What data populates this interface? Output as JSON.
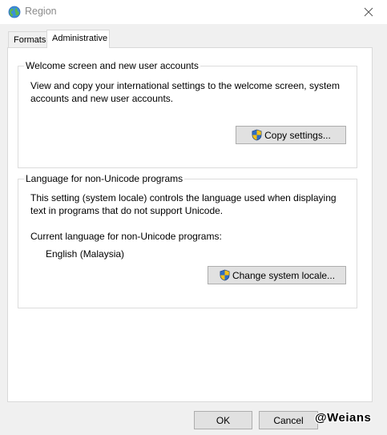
{
  "window": {
    "title": "Region",
    "icon": "globe-icon",
    "close_icon": "close-icon"
  },
  "tabs": [
    {
      "label": "Formats",
      "selected": false
    },
    {
      "label": "Administrative",
      "selected": true
    }
  ],
  "welcome_group": {
    "title": "Welcome screen and new user accounts",
    "description_line1": "View and copy your international settings to the welcome screen, system",
    "description_line2": "accounts and new user accounts.",
    "button_label": "Copy settings...",
    "button_icon": "uac-shield-icon"
  },
  "locale_group": {
    "title": "Language for non-Unicode programs",
    "description_line1": "This setting (system locale) controls the language used when displaying",
    "description_line2": "text in programs that do not support Unicode.",
    "current_label": "Current language for non-Unicode programs:",
    "current_value": "English (Malaysia)",
    "button_label": "Change system locale...",
    "button_icon": "uac-shield-icon"
  },
  "footer": {
    "ok_label": "OK",
    "cancel_label": "Cancel"
  },
  "watermark": "@Weians"
}
